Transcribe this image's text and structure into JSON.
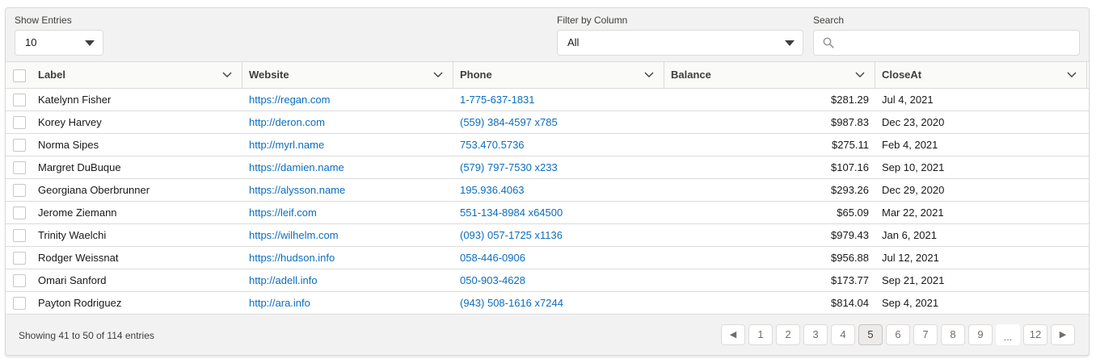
{
  "toolbar": {
    "show_entries_label": "Show Entries",
    "show_entries_value": "10",
    "filter_label": "Filter by Column",
    "filter_value": "All",
    "search_label": "Search",
    "search_value": ""
  },
  "table": {
    "columns": [
      "Label",
      "Website",
      "Phone",
      "Balance",
      "CloseAt"
    ],
    "rows": [
      [
        "Katelynn Fisher",
        "https://regan.com",
        "1-775-637-1831",
        "$281.29",
        "Jul 4, 2021"
      ],
      [
        "Korey Harvey",
        "http://deron.com",
        "(559) 384-4597 x785",
        "$987.83",
        "Dec 23, 2020"
      ],
      [
        "Norma Sipes",
        "http://myrl.name",
        "753.470.5736",
        "$275.11",
        "Feb 4, 2021"
      ],
      [
        "Margret DuBuque",
        "https://damien.name",
        "(579) 797-7530 x233",
        "$107.16",
        "Sep 10, 2021"
      ],
      [
        "Georgiana Oberbrunner",
        "https://alysson.name",
        "195.936.4063",
        "$293.26",
        "Dec 29, 2020"
      ],
      [
        "Jerome Ziemann",
        "https://leif.com",
        "551-134-8984 x64500",
        "$65.09",
        "Mar 22, 2021"
      ],
      [
        "Trinity Waelchi",
        "https://wilhelm.com",
        "(093) 057-1725 x1136",
        "$979.43",
        "Jan 6, 2021"
      ],
      [
        "Rodger Weissnat",
        "https://hudson.info",
        "058-446-0906",
        "$956.88",
        "Jul 12, 2021"
      ],
      [
        "Omari Sanford",
        "http://adell.info",
        "050-903-4628",
        "$173.77",
        "Sep 21, 2021"
      ],
      [
        "Payton Rodriguez",
        "http://ara.info",
        "(943) 508-1616 x7244",
        "$814.04",
        "Sep 4, 2021"
      ]
    ]
  },
  "footer": {
    "summary": "Showing 41 to 50 of 114 entries",
    "prev_icon": "◀",
    "next_icon": "▶",
    "pages": [
      "1",
      "2",
      "3",
      "4",
      "5",
      "6",
      "7",
      "8",
      "9",
      "...",
      "12"
    ],
    "current_page": "5"
  },
  "colors": {
    "link": "#0b6dbf",
    "border": "#dddbda",
    "card_bg": "#f3f2f2"
  }
}
